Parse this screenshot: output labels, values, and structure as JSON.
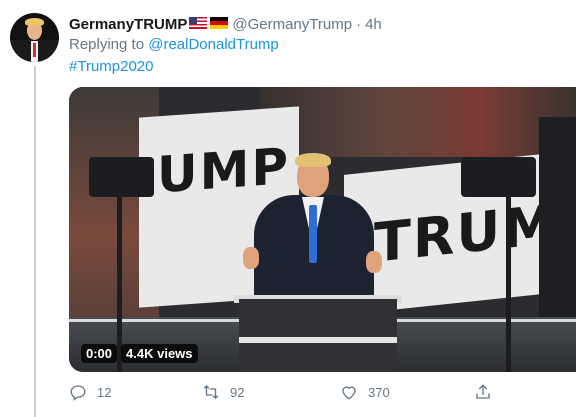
{
  "author": {
    "display_name": "GermanyTRUMP",
    "handle": "@GermanyTrump",
    "separator": "·",
    "time": "4h"
  },
  "reply": {
    "prefix": "Replying to ",
    "mention": "@realDonaldTrump"
  },
  "hashtag": "#Trump2020",
  "video": {
    "duration": "0:00",
    "views": "4.4K views",
    "sign_1_text": "UMP",
    "sign_2_text": "TRUM"
  },
  "actions": {
    "reply_count": "12",
    "retweet_count": "92",
    "like_count": "370"
  },
  "colors": {
    "link": "#1b95e0",
    "muted": "#657786",
    "text": "#14171a"
  },
  "icons": {
    "flag_1": "us-flag-icon",
    "flag_2": "germany-flag-icon",
    "reply": "reply-icon",
    "retweet": "retweet-icon",
    "like": "heart-icon",
    "share": "share-icon"
  }
}
